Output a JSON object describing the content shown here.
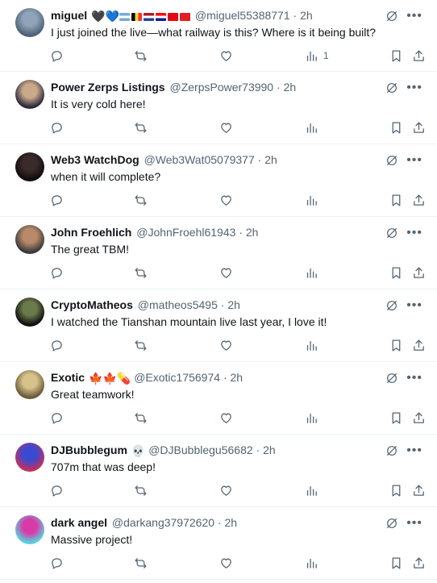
{
  "posts": [
    {
      "name": "miguel",
      "name_suffix": "🖤💙",
      "flags": [
        "argentina",
        "belgium",
        "netherlands",
        "croatia",
        "turkey",
        "albania"
      ],
      "handle": "@miguel55388771",
      "time": "2h",
      "text": "I just joined the live—what railway is this? Where is it being built?",
      "views": "1",
      "avatar_colors": [
        "#8fa4b8",
        "#4e6176"
      ]
    },
    {
      "name": "Power Zerps Listings",
      "handle": "@ZerpsPower73990",
      "time": "2h",
      "text": "It is very cold here!",
      "views": "",
      "avatar_colors": [
        "#c9a98a",
        "#2c2a3a"
      ]
    },
    {
      "name": "Web3 WatchDog",
      "handle": "@Web3Wat05079377",
      "time": "2h",
      "text": "when it will complete?",
      "views": "",
      "avatar_colors": [
        "#3a2a2a",
        "#120c10"
      ]
    },
    {
      "name": "John Froehlich",
      "handle": "@JohnFroehl61943",
      "time": "2h",
      "text": "The great TBM!",
      "views": "",
      "avatar_colors": [
        "#b98a6a",
        "#3a3a3a"
      ]
    },
    {
      "name": "CryptoMatheos",
      "handle": "@matheos5495",
      "time": "2h",
      "text": "I watched the Tianshan mountain live last year,  I love it!",
      "views": "",
      "avatar_colors": [
        "#6a7a4a",
        "#101010"
      ]
    },
    {
      "name": "Exotic",
      "name_suffix": "🍁🍁💊",
      "handle": "@Exotic1756974",
      "time": "2h",
      "text": "Great teamwork!",
      "views": "",
      "avatar_colors": [
        "#d6c28a",
        "#6b5a3a"
      ]
    },
    {
      "name": "DJBubblegum",
      "name_suffix": "💀",
      "handle": "@DJBubblegu56682",
      "time": "2h",
      "text": "707m that was deep!",
      "views": "",
      "avatar_colors": [
        "#3a4ad0",
        "#c03060"
      ]
    },
    {
      "name": "dark angel",
      "handle": "@darkang37972620",
      "time": "2h",
      "text": "Massive project!",
      "views": "",
      "avatar_colors": [
        "#d83aa8",
        "#5ad0e0"
      ]
    }
  ],
  "separator": "·",
  "more_glyph": "•••",
  "icons": {
    "reply": "reply-icon",
    "repost": "repost-icon",
    "like": "heart-icon",
    "views": "views-icon",
    "bookmark": "bookmark-icon",
    "share": "share-icon",
    "grok": "grok-icon",
    "more": "more-icon"
  },
  "colors": {
    "text": "#0f1419",
    "secondary": "#536471",
    "border": "#eff3f4",
    "flags": {
      "argentina": [
        "#75aadb",
        "#ffffff",
        "#75aadb"
      ],
      "belgium": [
        "#000000",
        "#fdda24",
        "#ef3340"
      ],
      "netherlands": [
        "#ae1c28",
        "#ffffff",
        "#21468b"
      ],
      "croatia": [
        "#ff0000",
        "#ffffff",
        "#171796"
      ],
      "turkey": [
        "#e30a17",
        "#e30a17",
        "#e30a17"
      ],
      "albania": [
        "#e41e20",
        "#e41e20",
        "#e41e20"
      ]
    }
  }
}
